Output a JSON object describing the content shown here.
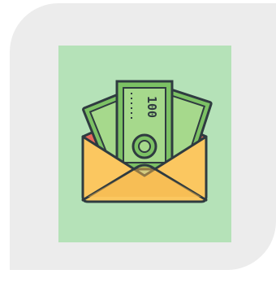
{
  "illustration": {
    "banknote_denomination": "100",
    "icon_name": "money-envelope-icon"
  },
  "colors": {
    "card_background": "#ececec",
    "tile_background": "#b5e2b8",
    "bill_green": "#7cc164",
    "bill_light": "#a6d98c",
    "envelope_yellow": "#fbc760",
    "envelope_flap": "#f3b64a",
    "envelope_inner": "#e8695a",
    "outline": "#2f3b40"
  }
}
